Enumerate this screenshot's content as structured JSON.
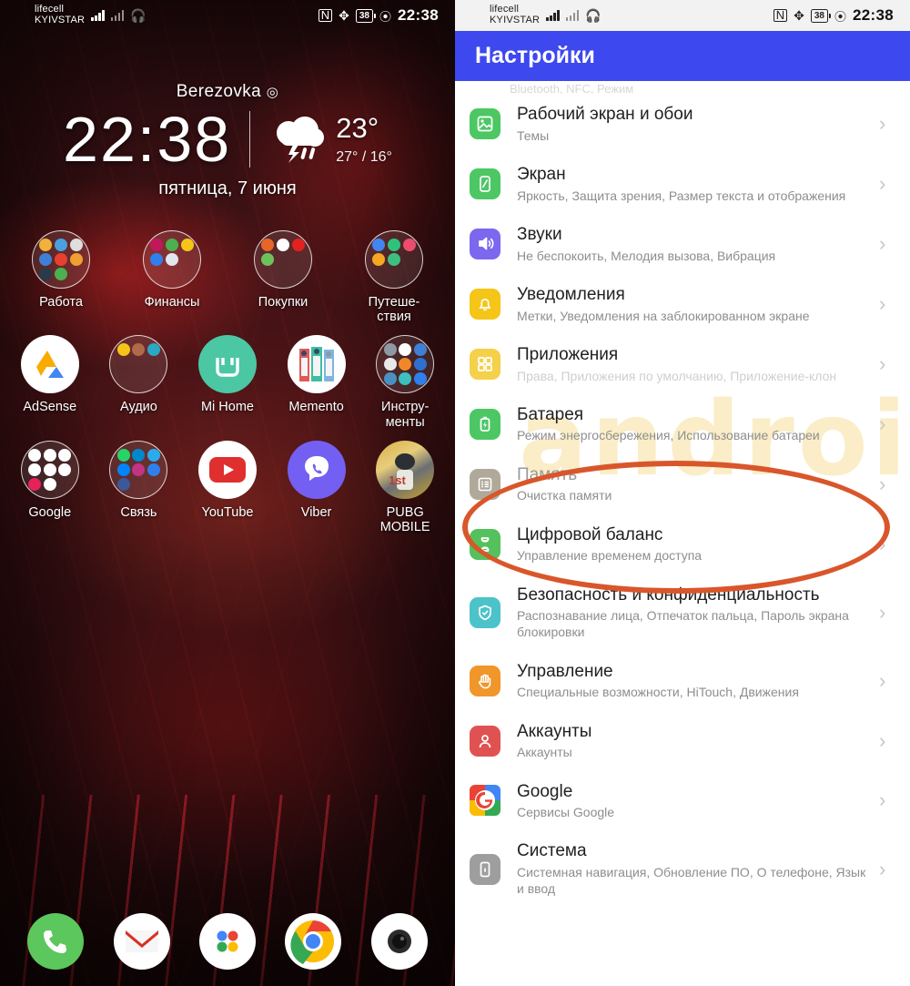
{
  "status_bar": {
    "carrier_line1": "lifecell",
    "carrier_line2": "KYIVSTAR",
    "battery_percent": "38",
    "time": "22:38",
    "icons": [
      "signal-bars-icon",
      "signal-bars-secondary-icon",
      "headphones-icon",
      "nfc-icon",
      "bluetooth-icon",
      "battery-icon",
      "eco-mode-icon"
    ]
  },
  "home_screen": {
    "widget": {
      "location": "Berezovka",
      "location_pin": "◎",
      "time": "22:38",
      "temp_current": "23°",
      "temp_high_low": "27° / 16°",
      "date": "пятница, 7 июня",
      "weather_icon": "thunderstorm-rain-icon"
    },
    "rows": [
      [
        {
          "label": "Работа",
          "type": "folder",
          "colors": [
            "#f2b138",
            "#4a9fe0",
            "#e0e0e0",
            "#3f7fd6",
            "#e8402f",
            "#f0a030",
            "#2b3a4a",
            "#4caf50",
            "#ffd24a"
          ]
        },
        {
          "label": "Финансы",
          "type": "folder",
          "colors": [
            "#c2185b",
            "#4caf50",
            "#f5c518",
            "#2f80ed",
            "#dfe6ec"
          ]
        },
        {
          "label": "Покупки",
          "type": "folder",
          "colors": [
            "#e8652a",
            "#ffffff",
            "#e2221f",
            "#6ec25a"
          ]
        },
        {
          "label": "Путеше-ствия",
          "type": "folder",
          "colors": [
            "#4285f4",
            "#2ec27e",
            "#ec4c6e",
            "#f5a623",
            "#3fbf7f"
          ]
        }
      ],
      [
        {
          "label": "AdSense",
          "type": "app",
          "icon": "adsense-icon",
          "bg": "#ffffff"
        },
        {
          "label": "Аудио",
          "type": "folder",
          "colors": [
            "#f5c518",
            "#b06a4a",
            "#2aa8c4"
          ]
        },
        {
          "label": "Mi Home",
          "type": "app",
          "icon": "mi-home-icon",
          "bg": "#4cc7a4"
        },
        {
          "label": "Memento",
          "type": "app",
          "icon": "memento-icon",
          "bg": "#ffffff"
        },
        {
          "label": "Инстру-менты",
          "type": "folder",
          "colors": [
            "#8d9aa5",
            "#ffffff",
            "#3f7fd6",
            "#e8e8e8",
            "#f0882a",
            "#2f6fd0",
            "#4a90c2",
            "#3dbfbf",
            "#2f80ed"
          ]
        }
      ],
      [
        {
          "label": "Google",
          "type": "folder",
          "colors": [
            "#ffffff",
            "#ffffff",
            "#ffffff",
            "#ffffff",
            "#ffffff",
            "#ffffff",
            "#e8215a",
            "#ffffff"
          ]
        },
        {
          "label": "Связь",
          "type": "folder",
          "colors": [
            "#25d366",
            "#0088cc",
            "#2aabee",
            "#0084ff",
            "#c13584",
            "#2f80ed",
            "#3b5998"
          ]
        },
        {
          "label": "YouTube",
          "type": "app",
          "icon": "youtube-icon",
          "bg": "#ffffff"
        },
        {
          "label": "Viber",
          "type": "app",
          "icon": "viber-icon",
          "bg": "#7360f2"
        },
        {
          "label": "PUBG MOBILE",
          "type": "app",
          "icon": "pubg-icon",
          "bg": "#c9a227"
        }
      ]
    ],
    "dock": [
      {
        "name": "phone-icon",
        "bg": "#5cc75c"
      },
      {
        "name": "gmail-icon",
        "bg": "#ffffff"
      },
      {
        "name": "app-drawer-icon",
        "bg": "#ffffff"
      },
      {
        "name": "chrome-icon",
        "bg": "#ffffff"
      },
      {
        "name": "camera-icon",
        "bg": "#ffffff"
      }
    ]
  },
  "settings": {
    "header_title": "Настройки",
    "header_color": "#3d48ef",
    "cut_off_row": "Bluetooth, NFC, Режим",
    "annotation": {
      "shape": "ellipse",
      "color": "#d9562b",
      "targets": "Батарея"
    },
    "watermark": "androidlime",
    "items": [
      {
        "title": "Рабочий экран и обои",
        "subtitle": "Темы",
        "icon": "wallpaper-icon",
        "color": "#4cc764"
      },
      {
        "title": "Экран",
        "subtitle": "Яркость, Защита зрения, Размер текста и отображения",
        "icon": "display-icon",
        "color": "#4cc764"
      },
      {
        "title": "Звуки",
        "subtitle": "Не беспокоить, Мелодия вызова, Вибрация",
        "icon": "speaker-icon",
        "color": "#7b68ee"
      },
      {
        "title": "Уведомления",
        "subtitle": "Метки, Уведомления на заблокированном экране",
        "icon": "bell-icon",
        "color": "#f5c518"
      },
      {
        "title": "Приложения",
        "subtitle": "Права, Приложения по умолчанию, Приложение-клон",
        "icon": "apps-grid-icon",
        "color": "#f5d04a"
      },
      {
        "title": "Батарея",
        "subtitle": "Режим энергосбережения, Использование батареи",
        "icon": "battery-charge-icon",
        "color": "#4cc764"
      },
      {
        "title": "Память",
        "subtitle": "Очистка памяти",
        "icon": "storage-icon",
        "color": "#b0a99a"
      },
      {
        "title": "Цифровой баланс",
        "subtitle": "Управление временем доступа",
        "icon": "hourglass-icon",
        "color": "#55c15c"
      },
      {
        "title": "Безопасность и конфиденциальность",
        "subtitle": "Распознавание лица, Отпечаток пальца, Пароль экрана блокировки",
        "icon": "shield-check-icon",
        "color": "#4cc3c9"
      },
      {
        "title": "Управление",
        "subtitle": "Специальные возможности, HiTouch, Движения",
        "icon": "hand-icon",
        "color": "#f0962a"
      },
      {
        "title": "Аккаунты",
        "subtitle": "Аккаунты",
        "icon": "person-icon",
        "color": "#e05252"
      },
      {
        "title": "Google",
        "subtitle": "Сервисы Google",
        "icon": "google-icon",
        "color": "#ffffff"
      },
      {
        "title": "Система",
        "subtitle": "Системная навигация, Обновление ПО, О телефоне, Язык и ввод",
        "icon": "phone-info-icon",
        "color": "#9e9e9e"
      }
    ],
    "chevron": "›"
  }
}
